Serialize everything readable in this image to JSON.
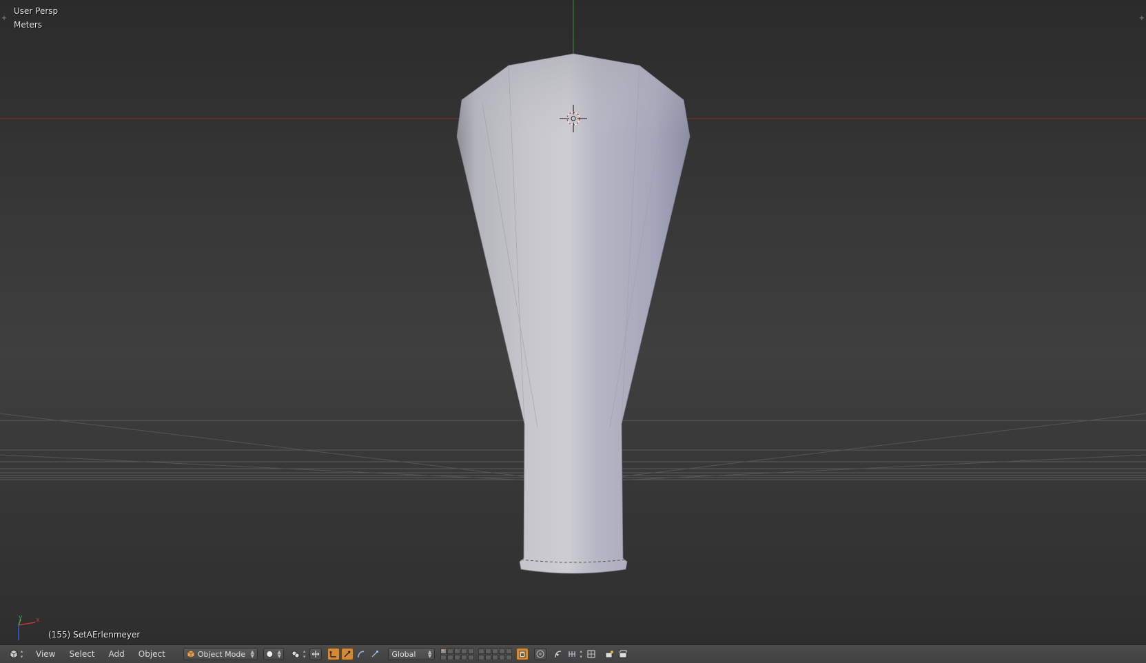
{
  "viewport": {
    "view_name": "User Persp",
    "units": "Meters",
    "object_info": "(155) SetAErlenmeyer",
    "axis_colors": {
      "x": "#c43a3a",
      "y": "#4aa84a",
      "z": "#3a5ad0"
    },
    "object_name": "SetAErlenmeyer",
    "frame": 155
  },
  "header": {
    "editor_type_icon": "3d-view-icon",
    "menus": [
      "View",
      "Select",
      "Add",
      "Object"
    ],
    "mode": {
      "label": "Object Mode",
      "icon": "object-cube-icon"
    },
    "viewport_shading": {
      "icon": "solid-sphere-icon"
    },
    "pivot_icon": "pivot-point-icon",
    "manipulator_icons": [
      "manipulator-toggle-icon",
      "translate-icon",
      "rotate-icon",
      "scale-icon"
    ],
    "transform_orientation": "Global",
    "layers_group_1": [
      true,
      false,
      false,
      false,
      false,
      false,
      false,
      false,
      false,
      false
    ],
    "layers_group_2": [
      false,
      false,
      false,
      false,
      false,
      false,
      false,
      false,
      false,
      false
    ],
    "extra_icons": [
      "lock-layer-icon",
      "proportional-edit-icon",
      "falloff-icon",
      "snap-toggle-icon",
      "snap-element-icon",
      "render-icon",
      "render-anim-icon"
    ],
    "accent_color": "#d08a3a"
  }
}
